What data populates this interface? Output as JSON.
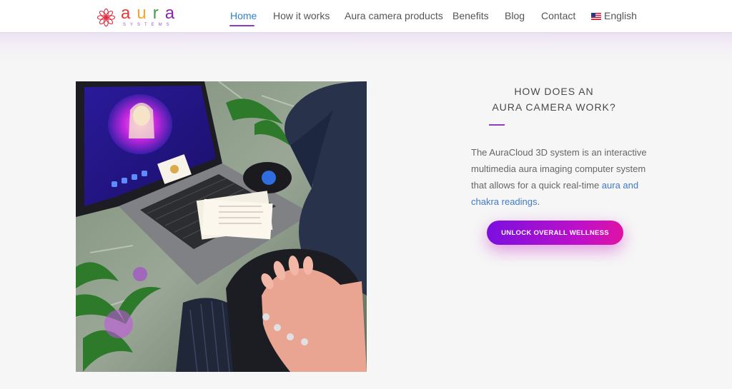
{
  "header": {
    "logo": {
      "word_letters": [
        "a",
        "u",
        "r",
        "a"
      ],
      "letter_colors": [
        "#e53935",
        "#f5a623",
        "#43a047",
        "#8e24aa"
      ],
      "subtitle": "SYSTEMS"
    },
    "nav": [
      {
        "label": "Home",
        "active": true
      },
      {
        "label": "How it works",
        "active": false
      },
      {
        "label": "Aura camera products",
        "active": false
      },
      {
        "label": "Benefits",
        "active": false
      },
      {
        "label": "Blog",
        "active": false
      },
      {
        "label": "Contact",
        "active": false
      }
    ],
    "language": {
      "label": "English",
      "flag_icon": "us-flag-icon"
    }
  },
  "main": {
    "heading_line1": "HOW DOES AN",
    "heading_line2": "AURA CAMERA WORK?",
    "description_text": "The AuraCloud 3D system is an interactive multimedia aura imaging computer system that allows for a quick real-time ",
    "description_link": "aura and chakra readings",
    "description_end": ".",
    "cta_label": "UNLOCK OVERALL WELLNESS"
  },
  "colors": {
    "accent_purple": "#8a3ec8",
    "nav_active": "#2f80d1",
    "link": "#3f79c9",
    "cta_gradient_start": "#7b0fe0",
    "cta_gradient_end": "#e012a4"
  }
}
